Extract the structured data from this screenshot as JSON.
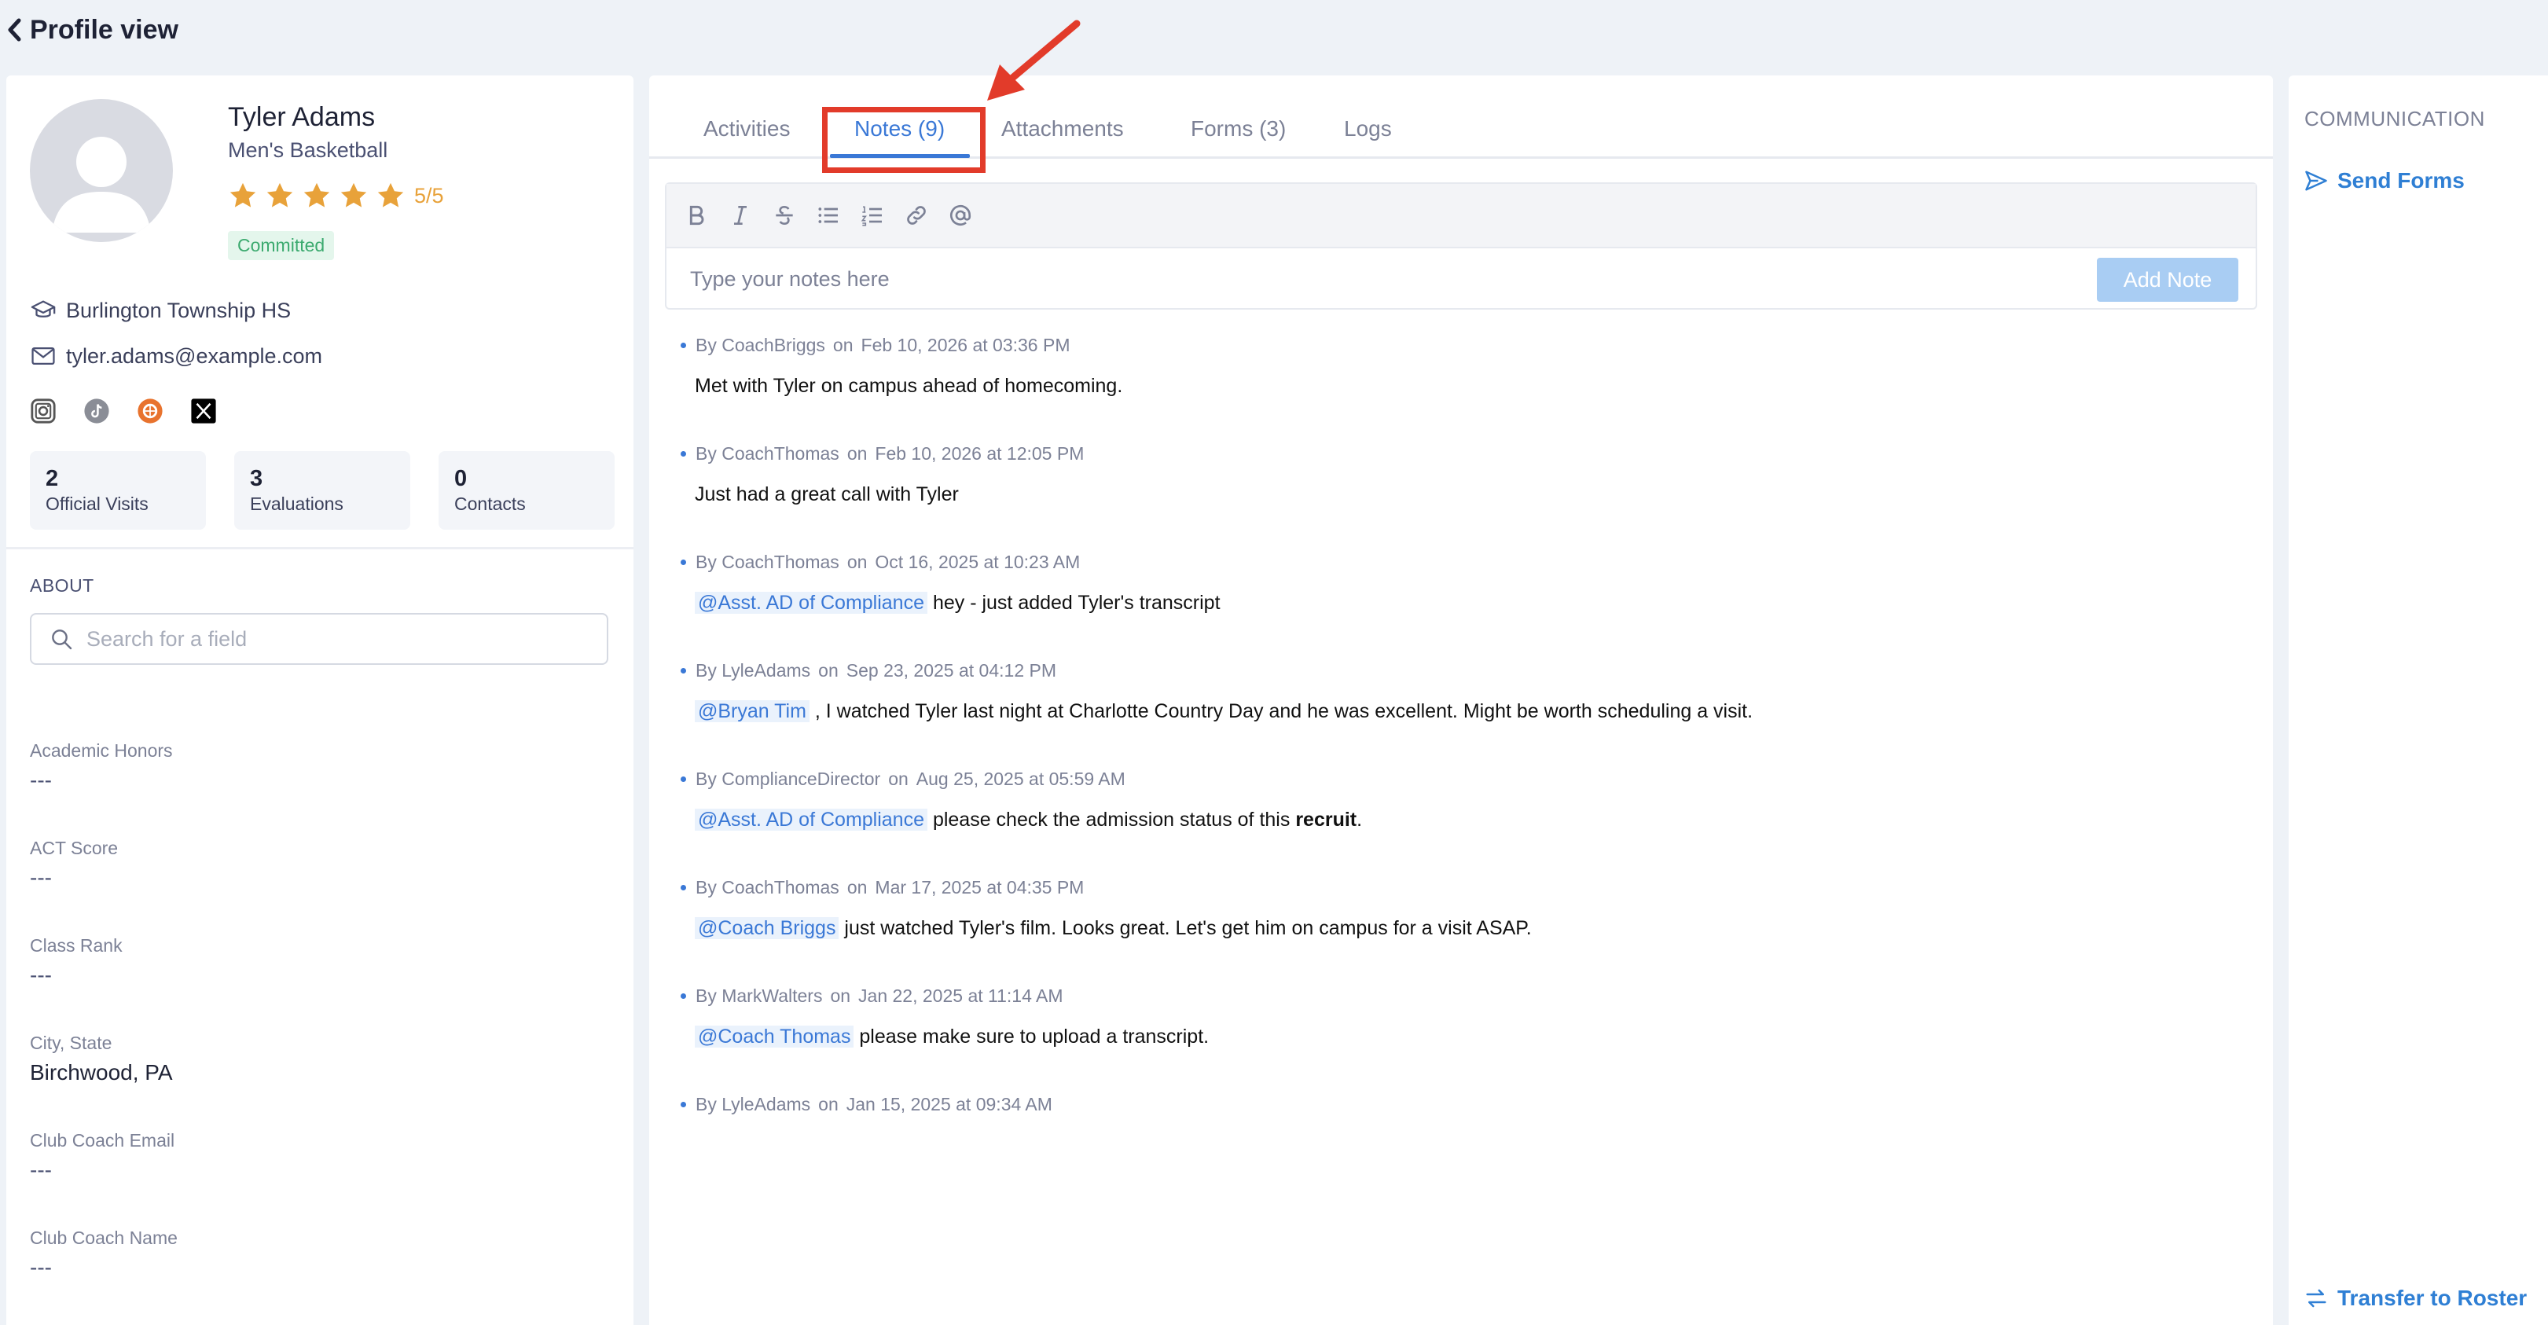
{
  "header": {
    "title": "Profile view"
  },
  "profile": {
    "name": "Tyler Adams",
    "sport": "Men's Basketball",
    "rating_text": "5/5",
    "rating_value": 5,
    "status": "Committed",
    "school": "Burlington Township HS",
    "email": "tyler.adams@example.com",
    "socials": [
      "instagram-icon",
      "tiktok-icon",
      "hudl-icon",
      "x-icon"
    ],
    "stats": [
      {
        "num": "2",
        "label": "Official Visits"
      },
      {
        "num": "3",
        "label": "Evaluations"
      },
      {
        "num": "0",
        "label": "Contacts"
      }
    ]
  },
  "about": {
    "heading": "ABOUT",
    "search_placeholder": "Search for a field",
    "fields": [
      {
        "label": "Academic Honors",
        "value": "---"
      },
      {
        "label": "ACT Score",
        "value": "---"
      },
      {
        "label": "Class Rank",
        "value": "---"
      },
      {
        "label": "City, State",
        "value": "Birchwood, PA"
      },
      {
        "label": "Club Coach Email",
        "value": "---"
      },
      {
        "label": "Club Coach Name",
        "value": "---"
      }
    ]
  },
  "tabs": [
    {
      "label": "Activities",
      "active": false
    },
    {
      "label": "Notes (9)",
      "active": true
    },
    {
      "label": "Attachments",
      "active": false
    },
    {
      "label": "Forms (3)",
      "active": false
    },
    {
      "label": "Logs",
      "active": false
    }
  ],
  "editor": {
    "placeholder": "Type your notes here",
    "add_label": "Add Note",
    "toolbar": [
      "bold-icon",
      "italic-icon",
      "strikethrough-icon",
      "bullet-list-icon",
      "numbered-list-icon",
      "link-icon",
      "mention-icon"
    ]
  },
  "notes": [
    {
      "by": "By CoachBriggs",
      "on": "on",
      "date": "Feb 10, 2026 at 03:36 PM",
      "parts": [
        {
          "t": "Met with Tyler on campus ahead of homecoming."
        }
      ]
    },
    {
      "by": "By CoachThomas",
      "on": "on",
      "date": "Feb 10, 2026 at 12:05 PM",
      "parts": [
        {
          "t": "Just had a great call with Tyler"
        }
      ]
    },
    {
      "by": "By CoachThomas",
      "on": "on",
      "date": "Oct 16, 2025 at 10:23 AM",
      "parts": [
        {
          "m": "@Asst. AD of Compliance"
        },
        {
          "t": " hey - just added Tyler's transcript"
        }
      ]
    },
    {
      "by": "By LyleAdams",
      "on": "on",
      "date": "Sep 23, 2025 at 04:12 PM",
      "parts": [
        {
          "m": "@Bryan Tim"
        },
        {
          "t": " , I watched Tyler last night at Charlotte Country Day and he was excellent. Might be worth scheduling a visit."
        }
      ]
    },
    {
      "by": "By ComplianceDirector",
      "on": "on",
      "date": "Aug 25, 2025 at 05:59 AM",
      "parts": [
        {
          "m": "@Asst. AD of Compliance"
        },
        {
          "t": " please check the admission status of this "
        },
        {
          "b": "recruit"
        },
        {
          "t": "."
        }
      ]
    },
    {
      "by": "By CoachThomas",
      "on": "on",
      "date": "Mar 17, 2025 at 04:35 PM",
      "parts": [
        {
          "m": "@Coach Briggs"
        },
        {
          "t": " just watched Tyler's film. Looks great. Let's get him on campus for a visit ASAP."
        }
      ]
    },
    {
      "by": "By MarkWalters",
      "on": "on",
      "date": "Jan 22, 2025 at 11:14 AM",
      "parts": [
        {
          "m": "@Coach Thomas"
        },
        {
          "t": " please make sure to upload a transcript."
        }
      ]
    },
    {
      "by": "By LyleAdams",
      "on": "on",
      "date": "Jan 15, 2025 at 09:34 AM",
      "parts": []
    }
  ],
  "communication": {
    "heading": "COMMUNICATION",
    "send_forms": "Send Forms",
    "transfer": "Transfer to Roster"
  },
  "colors": {
    "accent": "#3a78d6",
    "star": "#e8a23a",
    "highlight": "#e23b2a"
  }
}
